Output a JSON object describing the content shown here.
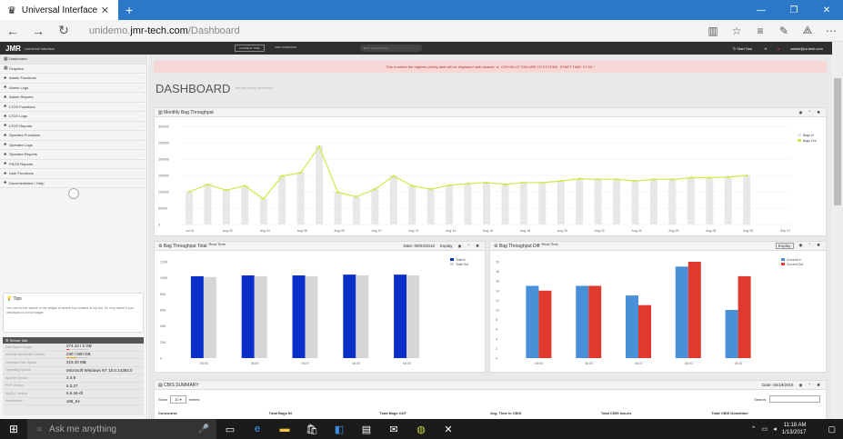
{
  "browser": {
    "tab_title": "Universal Interface",
    "tab_icon": "crown-icon",
    "url_prefix": "unidemo.",
    "url_host": "jmr-tech.com",
    "url_path": "/Dashboard"
  },
  "topnav": {
    "logo": "JMR",
    "logo_sub": "Universal Interface",
    "btn1": "CURRENT TIME",
    "btn2": "CBIS OVERVIEW",
    "search_placeholder": "Enter Keyword here...",
    "start_tour": "Start Tour",
    "user": "admin@ui-tech.com"
  },
  "sidebar": {
    "items": [
      {
        "label": "Dashboard",
        "chevron": ""
      },
      {
        "label": "Graphics",
        "chevron": ""
      },
      {
        "label": "Admin Functions",
        "chevron": "‹"
      },
      {
        "label": "Admin Logs",
        "chevron": "‹"
      },
      {
        "label": "Admin Reports",
        "chevron": "‹"
      },
      {
        "label": "LTOS Functions",
        "chevron": "‹"
      },
      {
        "label": "LTOS Logs",
        "chevron": "‹"
      },
      {
        "label": "LTOS Reports",
        "chevron": "‹"
      },
      {
        "label": "Operator Functions",
        "chevron": "‹"
      },
      {
        "label": "Operator Logs",
        "chevron": "‹"
      },
      {
        "label": "Operator Reports",
        "chevron": "‹"
      },
      {
        "label": "PSOS Reports",
        "chevron": "‹"
      },
      {
        "label": "User Functions",
        "chevron": "‹"
      },
      {
        "label": "Documentation / Help",
        "chevron": ""
      }
    ],
    "tips_title": "Tips",
    "tips_text": "You can do live search to the widget at search box located at top bar. It's very useful if your dashboard is full of widget.",
    "server_title": "Server Info",
    "server_rows": [
      {
        "k": "Disk Space Usage",
        "v": "274.43 / 2 GB"
      },
      {
        "k": "Monthly Bandwidth Transfer",
        "v": "230 / 500 GB"
      },
      {
        "k": "Database Disk Space",
        "v": "219.40 MB"
      },
      {
        "k": "Operating System",
        "v": "Microsoft Windows NT 10.0.14393.0"
      },
      {
        "k": "Apache Version",
        "v": "2.4.9"
      },
      {
        "k": "PHP Version",
        "v": "5.3.27"
      },
      {
        "k": "MySQL Version",
        "v": "5.5.34-cll"
      },
      {
        "k": "Architecture",
        "v": "x86_64"
      }
    ],
    "disk_fill": 0.14,
    "bw_fill": 0.46
  },
  "main": {
    "alert": "This is where the highest priority alert will be displayed until cleared. ie. CNY051-07 FAILURE TO EXTEND. START TIME: 07:15 *",
    "title": "DASHBOARD",
    "subtitle": "the first priority information",
    "monthly_title": "Monthly Bag Throughput",
    "bt_total_title": "Bag Throughput Total",
    "bt_total_realtime": "Real-Time",
    "bt_total_date": "Date: 09/03/2016",
    "bt_total_explay": "Explay",
    "bt_diff_title": "Bag Throughput Diff",
    "bt_diff_realtime": "Real-Time",
    "bt_diff_explay": "Explay",
    "cbis_title": "CBIS SUMMARY",
    "cbis_date": "Date: 05/19/2016",
    "show_label": "Show",
    "show_value": "10",
    "entries_label": "entries",
    "search_label": "Search:",
    "columns": [
      "Concourse",
      "Total Bags IN",
      "Total Bags OUT",
      "Avg. Time in CBIS",
      "Total CBIS Issues",
      "Total CBIS Downtime"
    ]
  },
  "chart_data": [
    {
      "type": "line",
      "title": "Monthly Bag Throughput",
      "x": [
        "Jul 31",
        "Aug 01",
        "Aug 02",
        "Aug 03",
        "Aug 04",
        "Aug 05",
        "Aug 06",
        "Aug 07",
        "Aug 08",
        "Aug 09",
        "Aug 10",
        "Aug 11",
        "Aug 12",
        "Aug 13",
        "Aug 14",
        "Aug 15",
        "Aug 16",
        "Aug 17",
        "Aug 18",
        "Aug 19",
        "Aug 20",
        "Aug 21",
        "Aug 22",
        "Aug 23",
        "Aug 24",
        "Aug 25",
        "Aug 26",
        "Aug 27",
        "Aug 28",
        "Aug 29",
        "Aug 30",
        "Aug 31",
        "Sep 01"
      ],
      "xticks": [
        "Jul 31",
        "Aug 02",
        "Aug 04",
        "Aug 06",
        "Aug 08",
        "Aug 10",
        "Aug 12",
        "Aug 14",
        "Aug 16",
        "Aug 18",
        "Aug 20",
        "Aug 22",
        "Aug 24",
        "Aug 26",
        "Aug 28",
        "Aug 30",
        "Sep 01"
      ],
      "yticks": [
        "0",
        "50000",
        "100000",
        "150000",
        "200000",
        "250000",
        "300000"
      ],
      "ylim": [
        0,
        300000
      ],
      "series": [
        {
          "name": "Bags In",
          "color": "#e8e8e8",
          "values": [
            100000,
            125000,
            105000,
            120000,
            80000,
            150000,
            160000,
            240000,
            100000,
            85000,
            110000,
            150000,
            120000,
            110000,
            120000,
            125000,
            130000,
            125000,
            130000,
            130000,
            135000,
            140000,
            140000,
            140000,
            135000,
            140000,
            140000,
            145000,
            145000,
            145000,
            150000
          ]
        },
        {
          "name": "Bags Out",
          "color": "#d4e84a",
          "values": [
            100000,
            122000,
            105000,
            118000,
            78000,
            148000,
            158000,
            238000,
            98000,
            85000,
            108000,
            148000,
            118000,
            108000,
            120000,
            125000,
            128000,
            123000,
            128000,
            128000,
            133000,
            140000,
            138000,
            138000,
            133000,
            138000,
            138000,
            143000,
            143000,
            145000,
            150000
          ]
        }
      ]
    },
    {
      "type": "bar",
      "title": "Bag Throughput Total",
      "categories": [
        "06:00",
        "06:00",
        "06:07",
        "06:00",
        "06:00"
      ],
      "yticks": [
        "0",
        "20K",
        "40K",
        "60K",
        "80K",
        "100K",
        "120K"
      ],
      "ylim": [
        0,
        120000
      ],
      "series": [
        {
          "name": "Total In",
          "color": "#0a2fc8",
          "values": [
            102000,
            103000,
            103000,
            104000,
            104000
          ]
        },
        {
          "name": "Total Out",
          "color": "#d6d6d6",
          "values": [
            101000,
            102000,
            102000,
            103000,
            103000
          ]
        }
      ]
    },
    {
      "type": "bar",
      "title": "Bag Throughput Diff",
      "categories": [
        "06:00",
        "06:00",
        "06:07",
        "06:00",
        "06:00"
      ],
      "yticks": [
        "0",
        "2",
        "4",
        "6",
        "8",
        "10",
        "12",
        "14",
        "16",
        "18",
        "20"
      ],
      "ylim": [
        0,
        20
      ],
      "series": [
        {
          "name": "Current In",
          "color": "#4a90d9",
          "values": [
            15,
            15,
            13,
            19,
            10
          ]
        },
        {
          "name": "Current Out",
          "color": "#e03a2f",
          "values": [
            14,
            15,
            11,
            20,
            17
          ]
        }
      ]
    }
  ],
  "taskbar": {
    "search_placeholder": "Ask me anything",
    "time": "11:18 AM",
    "date": "1/13/2017"
  }
}
